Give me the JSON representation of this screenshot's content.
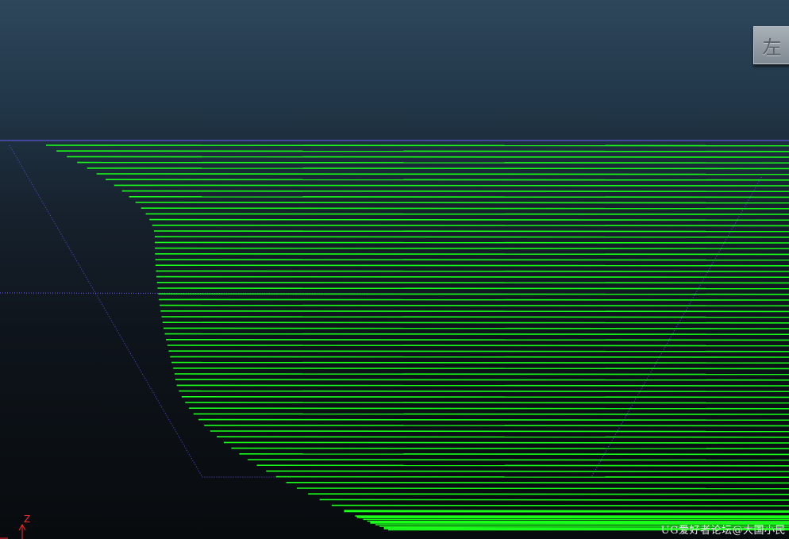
{
  "view_cube": {
    "label": "左"
  },
  "watermark": {
    "text": "UG爱好者论坛@大国小民"
  },
  "axis": {
    "z_label": "Z"
  },
  "colors": {
    "toolpath": "#1aff1a",
    "boundary": "#5a4fd8",
    "part_edge": "#6a5cff",
    "axis": "#ff2a2a"
  }
}
